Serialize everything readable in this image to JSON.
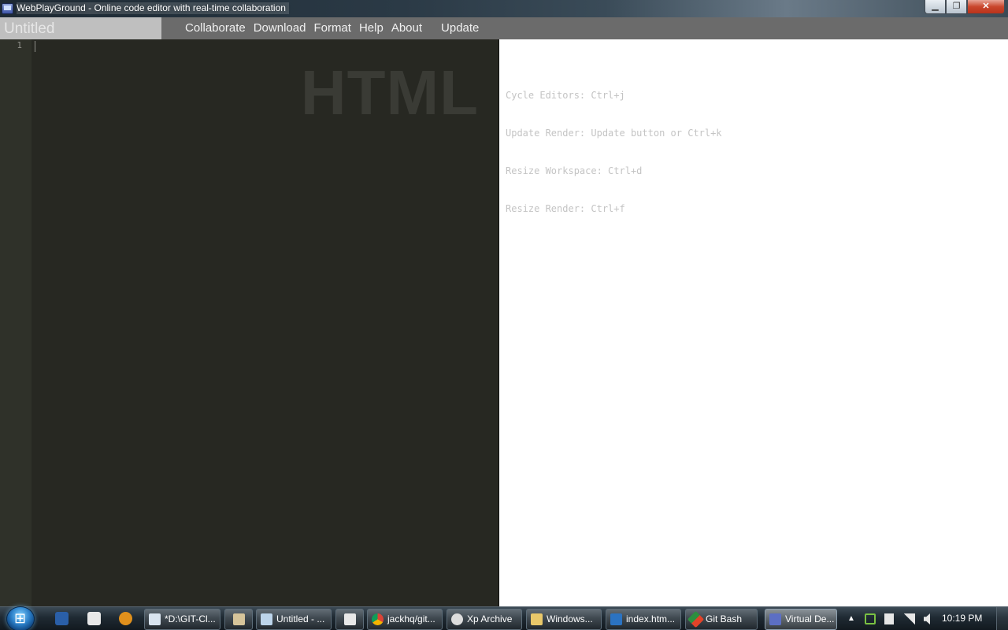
{
  "window": {
    "title": "WebPlayGround - Online code editor with real-time collaboration",
    "min_glyph": "▁",
    "max_glyph": "❐",
    "close_glyph": "✕"
  },
  "app": {
    "doc_name": "Untitled",
    "menu": {
      "collaborate": "Collaborate",
      "download": "Download",
      "format": "Format",
      "help": "Help",
      "about": "About",
      "update": "Update"
    }
  },
  "editor": {
    "line_number": "1",
    "mode_watermark": "HTML",
    "background": "#272822"
  },
  "render": {
    "hints": [
      "Cycle Editors: Ctrl+j",
      "Update Render: Update button or Ctrl+k",
      "Resize Workspace: Ctrl+d",
      "Resize Render: Ctrl+f"
    ]
  },
  "taskbar": {
    "tasks": {
      "git": "*D:\\GIT-Cl...",
      "untitled": "Untitled - ...",
      "chrome": "jackhq/git...",
      "xp": "Xp Archive",
      "windows": "Windows...",
      "index": "index.htm...",
      "gitbash": "Git Bash",
      "virtual": "Virtual De..."
    },
    "tray_arrow": "▲",
    "clock": "10:19 PM"
  }
}
